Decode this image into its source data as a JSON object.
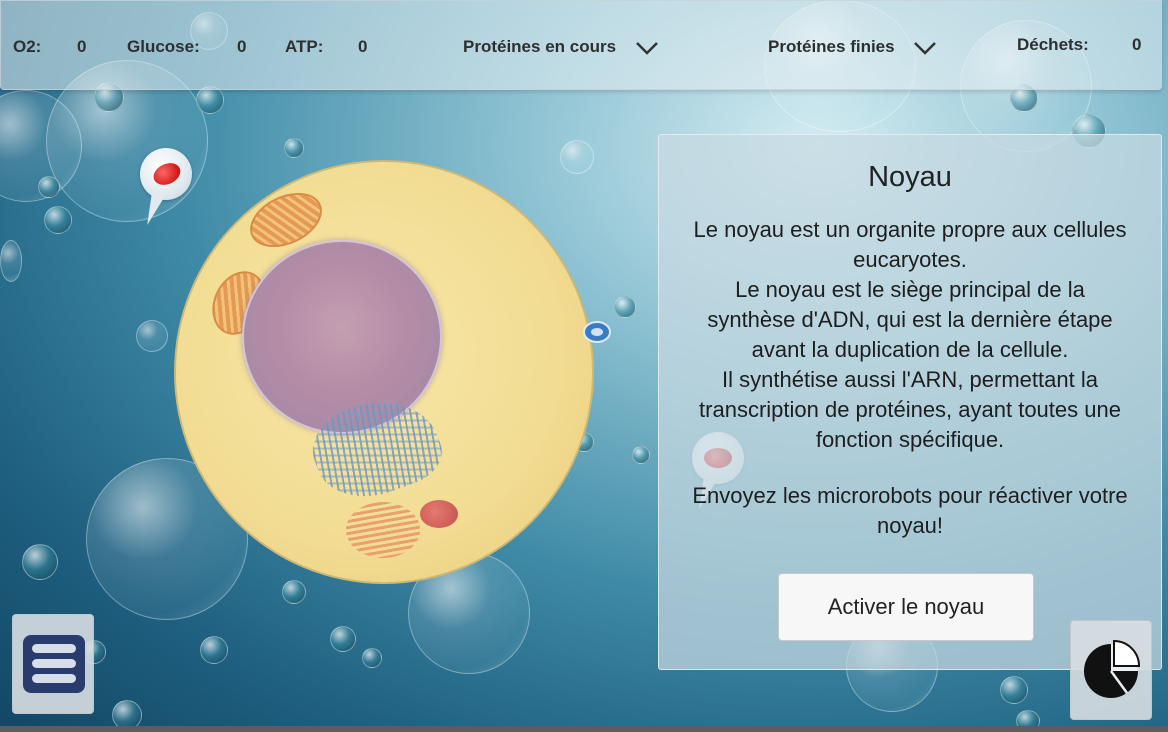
{
  "resources": {
    "o2_label": "O2:",
    "o2_value": "0",
    "glucose_label": "Glucose:",
    "glucose_value": "0",
    "atp_label": "ATP:",
    "atp_value": "0",
    "proteins_in_progress_label": "Protéines en cours",
    "proteins_finished_label": "Protéines finies",
    "waste_label": "Déchets:",
    "waste_value": "0"
  },
  "panel": {
    "title": "Noyau",
    "description": "Le noyau est un organite propre aux cellules\neucaryotes.\nLe noyau est le siège principal de la\nsynthèse d'ADN, qui est la dernière étape\navant la duplication de la cellule.\nIl synthétise aussi l'ARN, permettant la\ntranscription de protéines, ayant toutes une\nfonction spécifique.",
    "call_to_action": "Envoyez les microrobots pour réactiver votre\nnoyau!",
    "activate_button_label": "Activer le noyau"
  },
  "icons": {
    "dropdown": "chevron-down-icon",
    "menu": "hamburger-menu-icon",
    "stats": "pie-chart-icon",
    "pin": "map-pin-icon"
  },
  "colors": {
    "menu_button_bg": "#2a3c6e",
    "pin_blob": "#d01818"
  }
}
